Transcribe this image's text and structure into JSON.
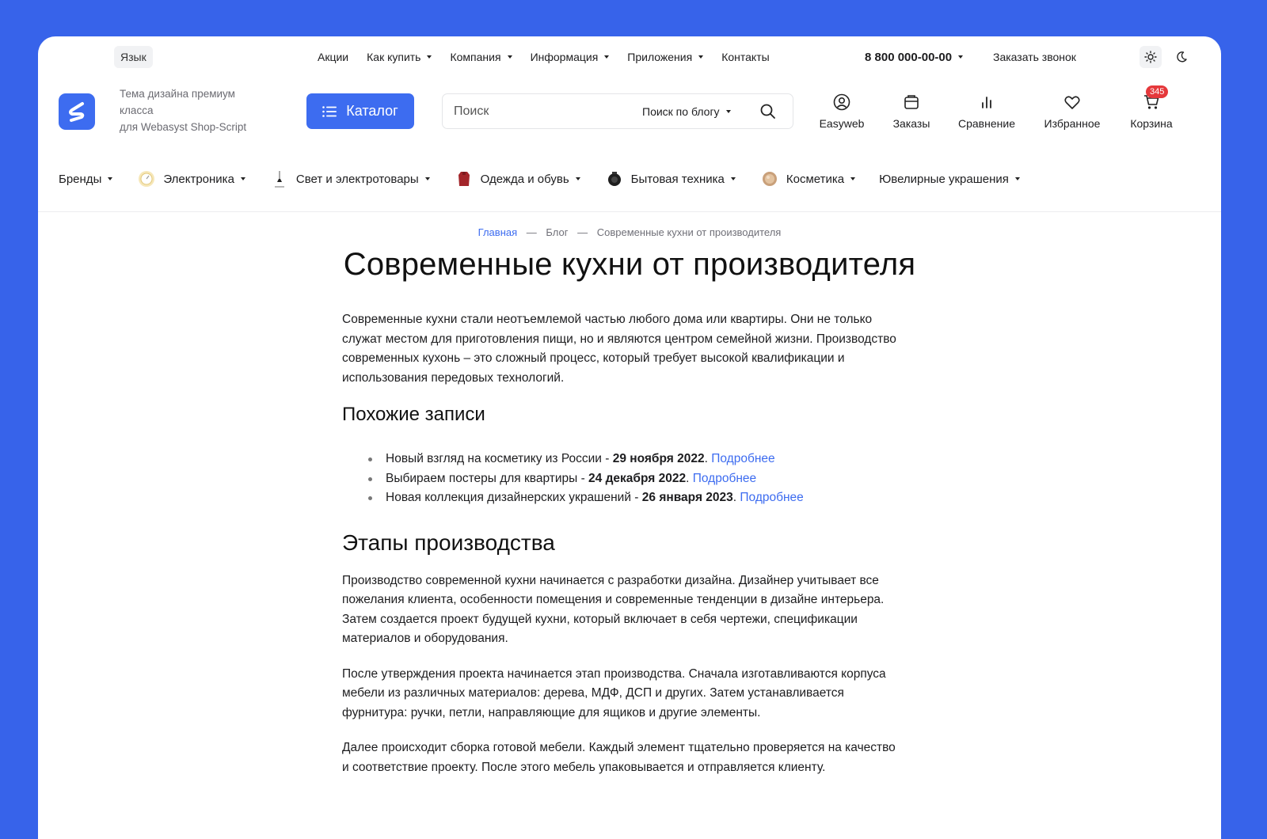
{
  "topbar": {
    "language": "Язык",
    "nav": [
      {
        "label": "Акции",
        "has_dropdown": false
      },
      {
        "label": "Как купить",
        "has_dropdown": true
      },
      {
        "label": "Компания",
        "has_dropdown": true
      },
      {
        "label": "Информация",
        "has_dropdown": true
      },
      {
        "label": "Приложения",
        "has_dropdown": true
      },
      {
        "label": "Контакты",
        "has_dropdown": false
      }
    ],
    "phone": "8 800 000-00-00",
    "callback": "Заказать звонок"
  },
  "header": {
    "tagline_line1": "Тема дизайна премиум",
    "tagline_line2": "класса",
    "tagline_line3": "для Webasyst Shop-Script",
    "catalog_label": "Каталог",
    "search_placeholder": "Поиск",
    "search_scope": "Поиск по блогу",
    "icons": [
      {
        "label": "Easyweb",
        "icon": "user-icon"
      },
      {
        "label": "Заказы",
        "icon": "orders-icon"
      },
      {
        "label": "Сравнение",
        "icon": "compare-icon"
      },
      {
        "label": "Избранное",
        "icon": "heart-icon"
      },
      {
        "label": "Корзина",
        "icon": "cart-icon"
      }
    ],
    "cart_count": "345"
  },
  "categories": [
    {
      "label": "Бренды",
      "icon": ""
    },
    {
      "label": "Электроника",
      "icon": "electronics-icon"
    },
    {
      "label": "Свет и электротовары",
      "icon": "lamp-icon"
    },
    {
      "label": "Одежда и обувь",
      "icon": "clothes-icon"
    },
    {
      "label": "Бытовая техника",
      "icon": "appliance-icon"
    },
    {
      "label": "Косметика",
      "icon": "cosmetics-icon"
    },
    {
      "label": "Ювелирные украшения",
      "icon": ""
    }
  ],
  "breadcrumb": {
    "home": "Главная",
    "blog": "Блог",
    "current": "Современные кухни от производителя"
  },
  "article": {
    "title": "Современные кухни от производителя",
    "intro": "Современные кухни стали неотъемлемой частью любого дома или квартиры. Они не только служат местом для приготовления пищи, но и являются центром семейной жизни. Производство современных кухонь – это сложный процесс, который требует высокой квалификации и использования передовых технологий.",
    "related_heading": "Похожие записи",
    "related": [
      {
        "text": "Новый взгляд на косметику из России - ",
        "date": "29 ноября 2022",
        "link": "Подробнее"
      },
      {
        "text": "Выбираем постеры для квартиры - ",
        "date": "24 декабря 2022",
        "link": "Подробнее"
      },
      {
        "text": "Новая коллекция дизайнерских украшений - ",
        "date": "26 января 2023",
        "link": "Подробнее"
      }
    ],
    "stages_heading": "Этапы производства",
    "p1": "Производство современной кухни начинается с разработки дизайна. Дизайнер учитывает все пожелания клиента, особенности помещения и современные тенденции в дизайне интерьера. Затем создается проект будущей кухни, который включает в себя чертежи, спецификации материалов и оборудования.",
    "p2": "После утверждения проекта начинается этап производства. Сначала изготавливаются корпуса мебели из различных материалов: дерева, МДФ, ДСП и других. Затем устанавливается фурнитура: ручки, петли, направляющие для ящиков и другие элементы.",
    "p3": "Далее происходит сборка готовой мебели. Каждый элемент тщательно проверяется на качество и соответствие проекту. После этого мебель упаковывается и отправляется клиенту."
  },
  "colors": {
    "background": "#3763ea",
    "accent": "#3d6cf0",
    "badge": "#e5383b"
  }
}
